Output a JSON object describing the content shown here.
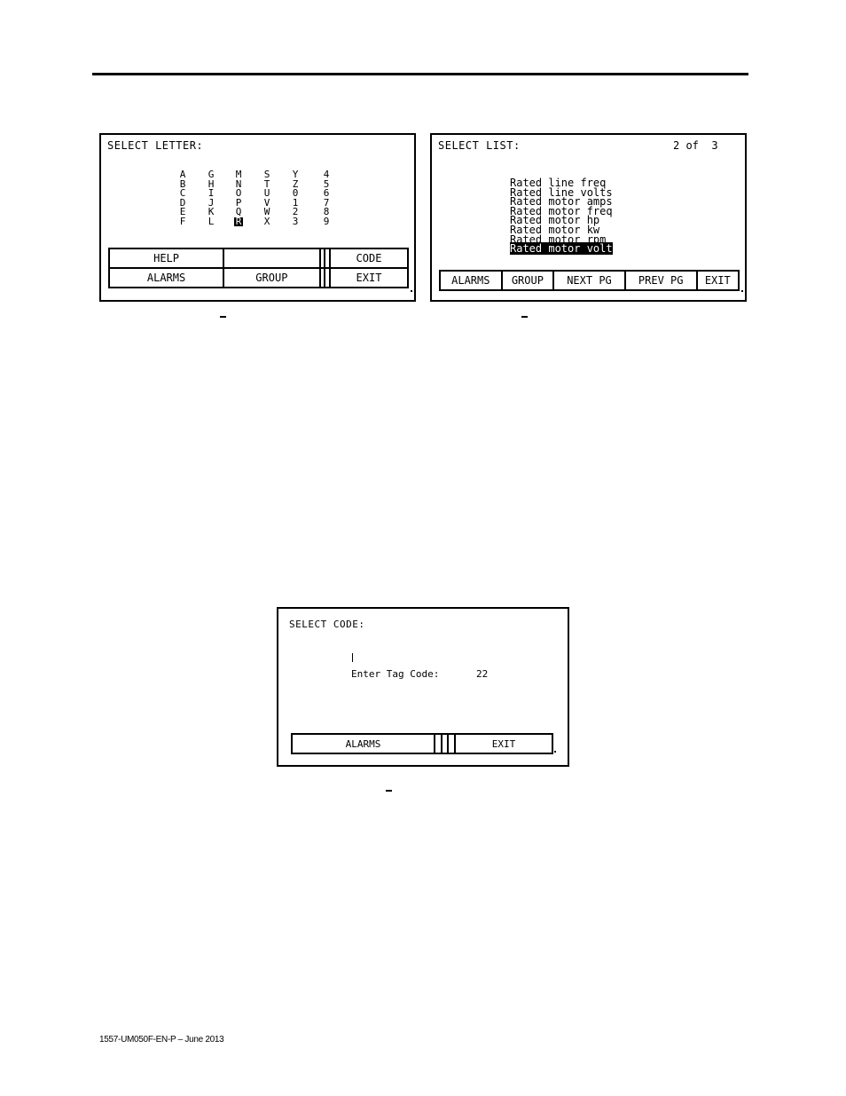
{
  "screens": {
    "select_letter": {
      "title": "SELECT LETTER:",
      "columns": [
        [
          "A",
          "B",
          "C",
          "D",
          "E",
          "F"
        ],
        [
          "G",
          "H",
          "I",
          "J",
          "K",
          "L"
        ],
        [
          "M",
          "N",
          "O",
          "P",
          "Q",
          "R"
        ],
        [
          "S",
          "T",
          "U",
          "V",
          "W",
          "X"
        ],
        [
          "Y",
          "Z",
          "0",
          "1",
          "2",
          "3"
        ],
        [
          "4",
          "5",
          "6",
          "7",
          "8",
          "9"
        ]
      ],
      "selected_letter": "R",
      "keys_row1": [
        "HELP",
        "",
        "",
        "",
        "CODE"
      ],
      "keys_row2": [
        "ALARMS",
        "GROUP",
        "",
        "",
        "EXIT"
      ]
    },
    "select_list": {
      "title": "SELECT LIST:",
      "page_indicator": "2 of  3",
      "items": [
        "Rated line freq",
        "Rated line volts",
        "Rated motor amps",
        "Rated motor freq",
        "Rated motor hp",
        "Rated motor kw",
        "Rated motor rpm",
        "Rated motor volt"
      ],
      "selected_index": 7,
      "keys": [
        "ALARMS",
        "GROUP",
        "NEXT PG",
        "PREV PG",
        "EXIT"
      ]
    },
    "select_code": {
      "title": "SELECT CODE:",
      "prompt_label": "Enter Tag Code:",
      "prompt_value": "22",
      "keys": [
        "ALARMS",
        "",
        "",
        "",
        "EXIT"
      ]
    }
  },
  "footer": {
    "doc_id": "1557-UM050F-EN-P – June 2013"
  }
}
